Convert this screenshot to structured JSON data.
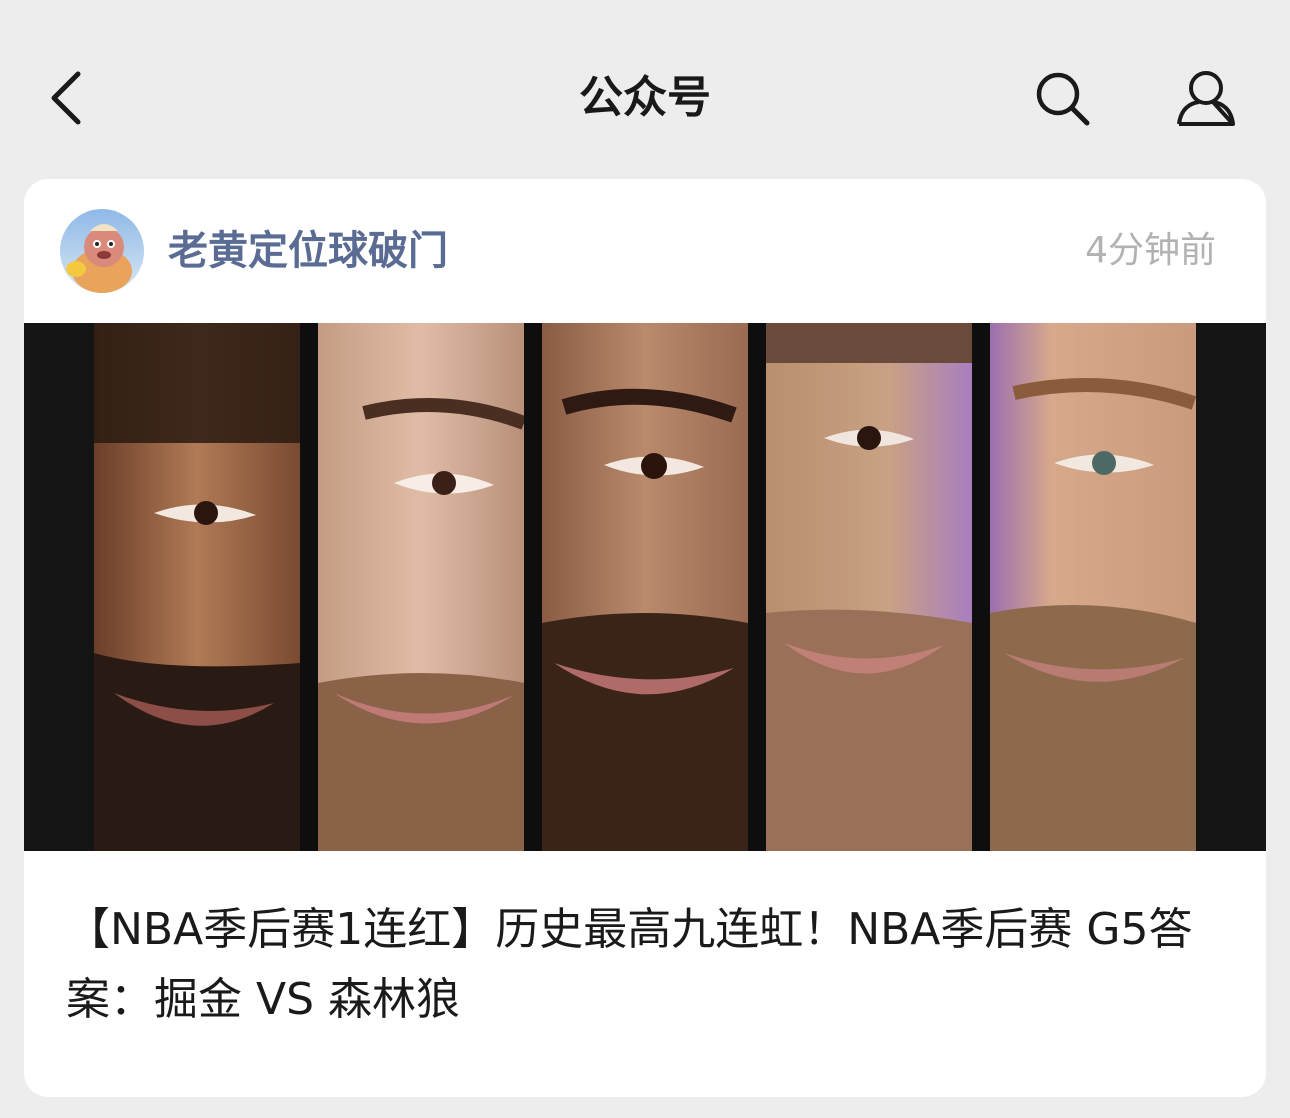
{
  "topbar": {
    "title": "公众号",
    "back_icon": "chevron-left-icon",
    "search_icon": "search-icon",
    "profile_icon": "person-icon"
  },
  "post": {
    "account_name": "老黄定位球破门",
    "time": "4分钟前",
    "cover_description_icon": "image-cover",
    "title": "【NBA季后赛1连红】历史最高九连虹！NBA季后赛 G5答案：掘金 VS 森林狼"
  },
  "colors": {
    "background": "#ededed",
    "card": "#ffffff",
    "account_name": "#5a6c94",
    "time": "#b2b2b2",
    "title_text": "#1a1a1a"
  }
}
